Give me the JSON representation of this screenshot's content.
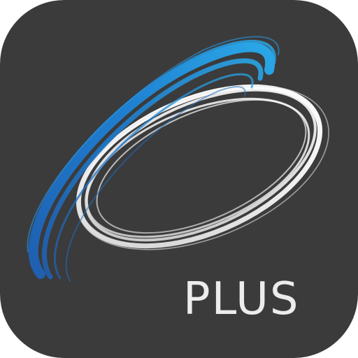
{
  "icon": {
    "label": "PLUS",
    "colors": {
      "background": "#3b3b3c",
      "accent_blue_light": "#2aa2e3",
      "accent_blue_dark": "#1f5fb0",
      "ring_white": "#e9e9e9",
      "label": "#ececec"
    },
    "logo": {
      "icon_name": "orbit-rings-icon"
    }
  }
}
